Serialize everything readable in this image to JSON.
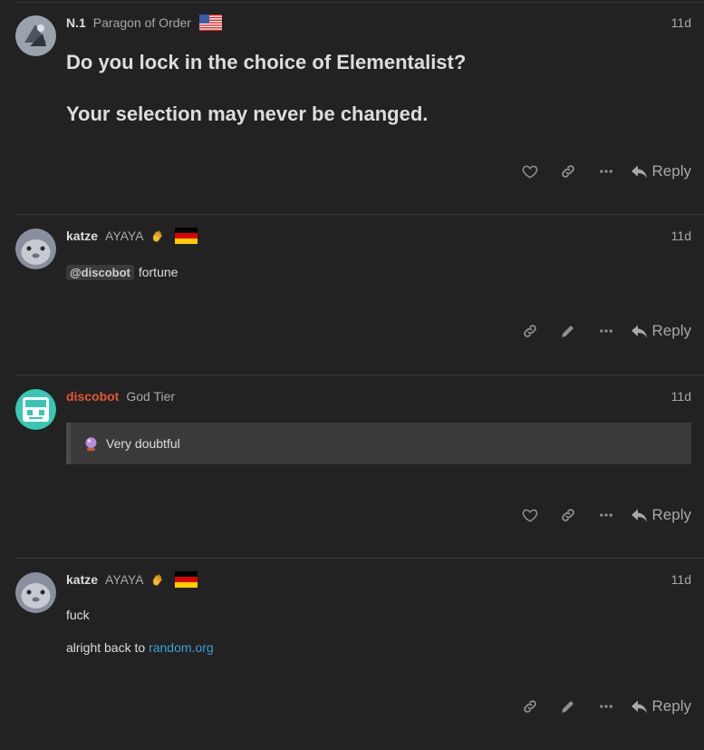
{
  "posts": [
    {
      "username": "N.1",
      "user_title": "Paragon of Order",
      "flag_icon": "us-flag-icon",
      "date": "11d",
      "lines": [
        "Do you lock in the choice of Elementalist?",
        "Your selection may never be changed."
      ],
      "reply_label": "Reply"
    },
    {
      "username": "katze",
      "user_title": "AYAYA",
      "flag_icon": "germany-flag-icon",
      "date": "11d",
      "mention": "@discobot",
      "text": "fortune",
      "reply_label": "Reply"
    },
    {
      "username": "discobot",
      "user_title": "God Tier",
      "date": "11d",
      "quote_text": "Very doubtful",
      "reply_label": "Reply"
    },
    {
      "username": "katze",
      "user_title": "AYAYA",
      "flag_icon": "germany-flag-icon",
      "date": "11d",
      "line1": "fuck",
      "line2_prefix": "alright back to",
      "link_text": "random.org",
      "reply_label": "Reply"
    }
  ],
  "colors": {
    "background": "#222222",
    "bot_name": "#e45735",
    "link": "#3d9fd8"
  }
}
